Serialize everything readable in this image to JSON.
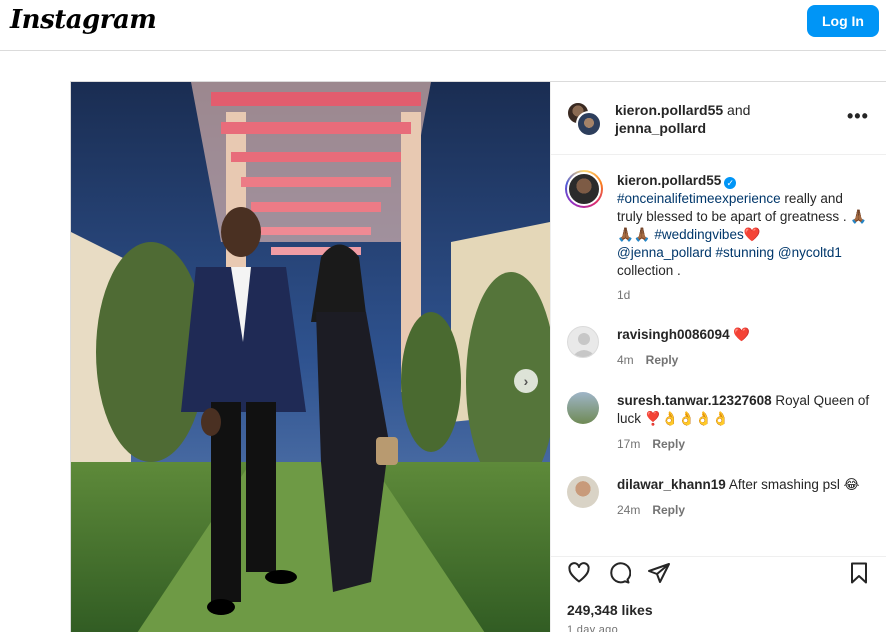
{
  "header": {
    "logo": "Instagram",
    "login_label": "Log In"
  },
  "post": {
    "owners_prefix": "kieron.pollard55",
    "owners_joiner": " and",
    "owners_second": "jenna_pollard",
    "more_icon": "more-horizontal-icon",
    "carousel_next_icon": "chevron-right-icon",
    "caption": {
      "username": "kieron.pollard55",
      "verified_icon": "verified-badge-icon",
      "hashtag1": "#onceinalifetimeexperience",
      "text1": " really and truly blessed to be apart of greatness . ",
      "emoji1": "🙏🏾🙏🏾🙏🏾",
      "hashtag2": "#weddingvibes",
      "emoji2": "❤️",
      "mention1": "@jenna_pollard",
      "hashtag3": "#stunning",
      "mention2": "@nycoltd1",
      "text2": " collection .",
      "time": "1d"
    },
    "comments": [
      {
        "username": "ravisingh0086094",
        "text": " ❤️",
        "time": "4m",
        "reply": "Reply"
      },
      {
        "username": "suresh.tanwar.12327608",
        "text": " Royal Queen of luck ❣️👌👌👌👌",
        "time": "17m",
        "reply": "Reply"
      },
      {
        "username": "dilawar_khann19",
        "text": " After smashing psl 😂",
        "time": "24m",
        "reply": "Reply"
      }
    ],
    "actions": {
      "like_icon": "heart-icon",
      "comment_icon": "comment-icon",
      "share_icon": "share-icon",
      "save_icon": "bookmark-icon"
    },
    "likes": "249,348 likes",
    "posted": "1 day ago"
  }
}
